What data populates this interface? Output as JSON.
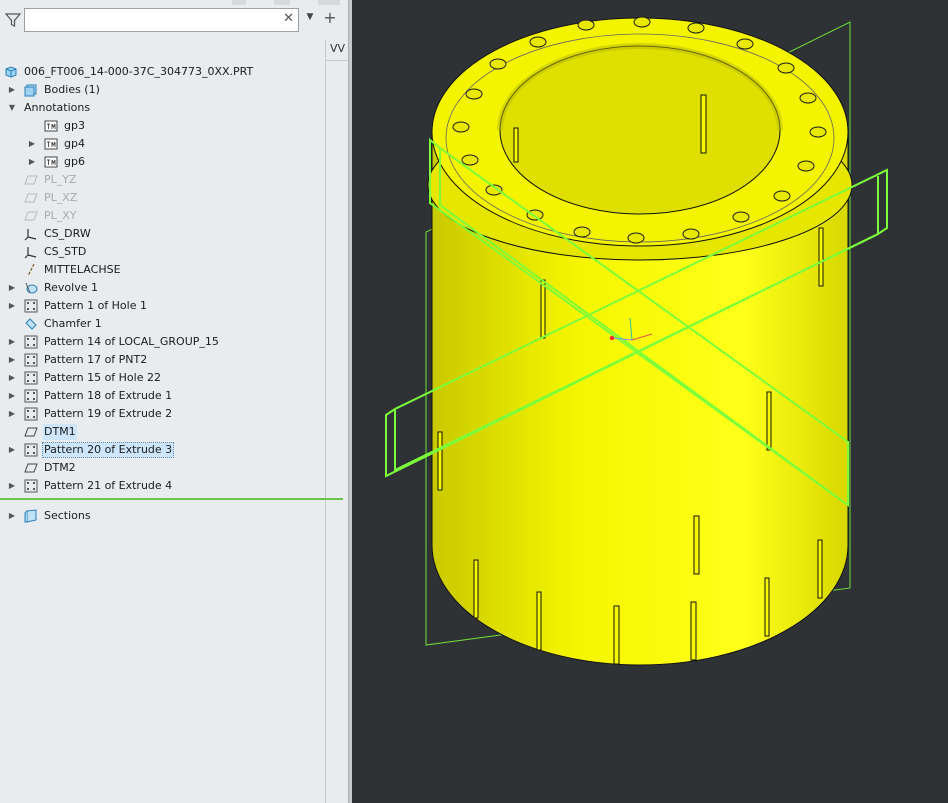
{
  "search": {
    "value": "",
    "placeholder": ""
  },
  "column_header": "VV",
  "tree": {
    "root": "006_FT006_14-000-37C_304773_0XX.PRT",
    "items": [
      {
        "label": "Bodies (1)",
        "icon": "bodies-icon",
        "expandable": true
      },
      {
        "label": "Annotations",
        "icon": "none",
        "expandable": true,
        "expanded": true
      },
      {
        "label": "gp3",
        "icon": "annotation-icon",
        "expandable": false
      },
      {
        "label": "gp4",
        "icon": "annotation-icon",
        "expandable": true
      },
      {
        "label": "gp6",
        "icon": "annotation-icon",
        "expandable": true
      },
      {
        "label": "PL_YZ",
        "icon": "datum-plane-icon",
        "hidden": true
      },
      {
        "label": "PL_XZ",
        "icon": "datum-plane-icon",
        "hidden": true
      },
      {
        "label": "PL_XY",
        "icon": "datum-plane-icon",
        "hidden": true
      },
      {
        "label": "CS_DRW",
        "icon": "coordinate-system-icon"
      },
      {
        "label": "CS_STD",
        "icon": "coordinate-system-icon"
      },
      {
        "label": "MITTELACHSE",
        "icon": "datum-axis-icon"
      },
      {
        "label": "Revolve 1",
        "icon": "revolve-icon",
        "expandable": true
      },
      {
        "label": "Pattern 1 of Hole 1",
        "icon": "pattern-icon",
        "expandable": true
      },
      {
        "label": "Chamfer 1",
        "icon": "chamfer-icon"
      },
      {
        "label": "Pattern 14 of LOCAL_GROUP_15",
        "icon": "pattern-icon",
        "expandable": true
      },
      {
        "label": "Pattern 17 of PNT2",
        "icon": "pattern-icon",
        "expandable": true
      },
      {
        "label": "Pattern 15 of Hole 22",
        "icon": "pattern-icon",
        "expandable": true
      },
      {
        "label": "Pattern 18 of Extrude 1",
        "icon": "pattern-icon",
        "expandable": true
      },
      {
        "label": "Pattern 19 of Extrude 2",
        "icon": "pattern-icon",
        "expandable": true
      },
      {
        "label": "DTM1",
        "icon": "datum-plane-icon",
        "highlighted": true
      },
      {
        "label": "Pattern 20 of Extrude 3",
        "icon": "pattern-icon",
        "expandable": true,
        "selected": true
      },
      {
        "label": "DTM2",
        "icon": "datum-plane-icon"
      },
      {
        "label": "Pattern 21 of Extrude 4",
        "icon": "pattern-icon",
        "expandable": true
      }
    ],
    "sections": "Sections"
  },
  "colors": {
    "model_yellow": "#f2f200",
    "highlight_green": "#7cff3a",
    "viewport_bg": "#2f3234",
    "panel_bg": "#e8ecee",
    "selection_blue": "#cde6fb"
  }
}
